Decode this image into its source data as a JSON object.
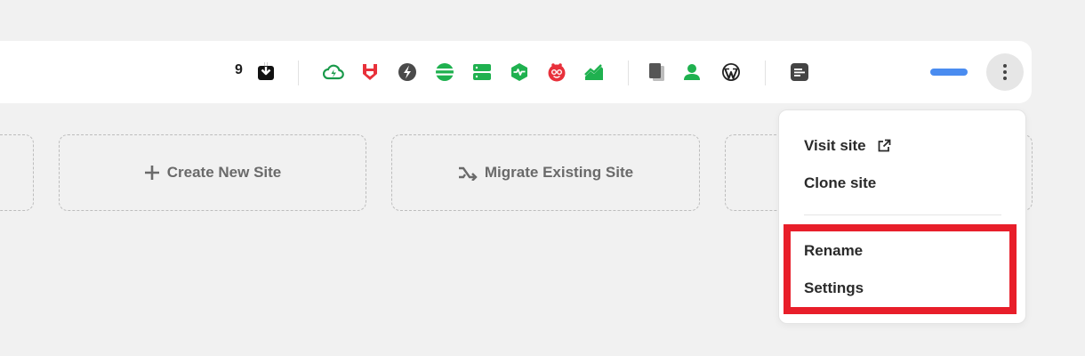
{
  "toolbar": {
    "notification_count": "9",
    "icons": [
      {
        "name": "download-icon",
        "color": "#111111"
      },
      {
        "name": "cloud-bolt-icon",
        "color": "#1a9a4b"
      },
      {
        "name": "shield-badge-icon",
        "color": "#e8313b"
      },
      {
        "name": "bolt-circle-icon",
        "color": "#4a4a4a"
      },
      {
        "name": "layers-circle-icon",
        "color": "#1fb14f"
      },
      {
        "name": "server-icon",
        "color": "#1fb14f"
      },
      {
        "name": "heartbeat-hexagon-icon",
        "color": "#1fb14f"
      },
      {
        "name": "cookie-face-icon",
        "color": "#e8313b"
      },
      {
        "name": "trend-chart-icon",
        "color": "#1fb14f"
      },
      {
        "name": "copy-pages-icon",
        "color": "#555555"
      },
      {
        "name": "user-icon",
        "color": "#1fb14f"
      },
      {
        "name": "wordpress-icon",
        "color": "#222222"
      },
      {
        "name": "notes-icon",
        "color": "#444444"
      }
    ],
    "accent_color": "#4a8cf0"
  },
  "cards": {
    "create_label": "Create New Site",
    "migrate_label": "Migrate Existing Site"
  },
  "menu": {
    "visit_label": "Visit site",
    "clone_label": "Clone site",
    "rename_label": "Rename",
    "settings_label": "Settings"
  },
  "highlight_color": "#e81e2a"
}
